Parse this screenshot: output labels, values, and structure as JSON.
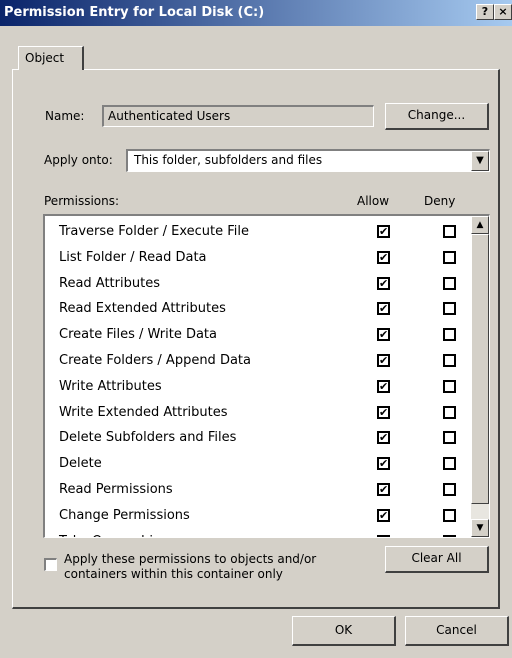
{
  "window": {
    "title": "Permission Entry for Local Disk (C:)",
    "help_label": "?",
    "close_label": "×"
  },
  "tabs": [
    {
      "label": "Object"
    }
  ],
  "name_row": {
    "label": "Name:",
    "value": "Authenticated Users",
    "change_label": "Change..."
  },
  "apply_onto": {
    "label": "Apply onto:",
    "selected": "This folder, subfolders and files"
  },
  "permissions": {
    "header": "Permissions:",
    "allow_header": "Allow",
    "deny_header": "Deny",
    "items": [
      {
        "name": "Traverse Folder / Execute File",
        "allow": true,
        "deny": false
      },
      {
        "name": "List Folder / Read Data",
        "allow": true,
        "deny": false
      },
      {
        "name": "Read Attributes",
        "allow": true,
        "deny": false
      },
      {
        "name": "Read Extended Attributes",
        "allow": true,
        "deny": false
      },
      {
        "name": "Create Files / Write Data",
        "allow": true,
        "deny": false
      },
      {
        "name": "Create Folders / Append Data",
        "allow": true,
        "deny": false
      },
      {
        "name": "Write Attributes",
        "allow": true,
        "deny": false
      },
      {
        "name": "Write Extended Attributes",
        "allow": true,
        "deny": false
      },
      {
        "name": "Delete Subfolders and Files",
        "allow": true,
        "deny": false
      },
      {
        "name": "Delete",
        "allow": true,
        "deny": false
      },
      {
        "name": "Read Permissions",
        "allow": true,
        "deny": false
      },
      {
        "name": "Change Permissions",
        "allow": true,
        "deny": false
      },
      {
        "name": "Take Ownership",
        "allow": true,
        "deny": false
      }
    ]
  },
  "apply_inherit": {
    "label_line1": "Apply these permissions to objects and/or",
    "label_line2": "containers within this container only",
    "checked": false
  },
  "buttons": {
    "clear_all": "Clear All",
    "ok": "OK",
    "cancel": "Cancel"
  },
  "check_glyph": "✔",
  "colors": {
    "title_start": "#0a246a",
    "title_end": "#a6caf0",
    "face": "#d4d0c8"
  }
}
